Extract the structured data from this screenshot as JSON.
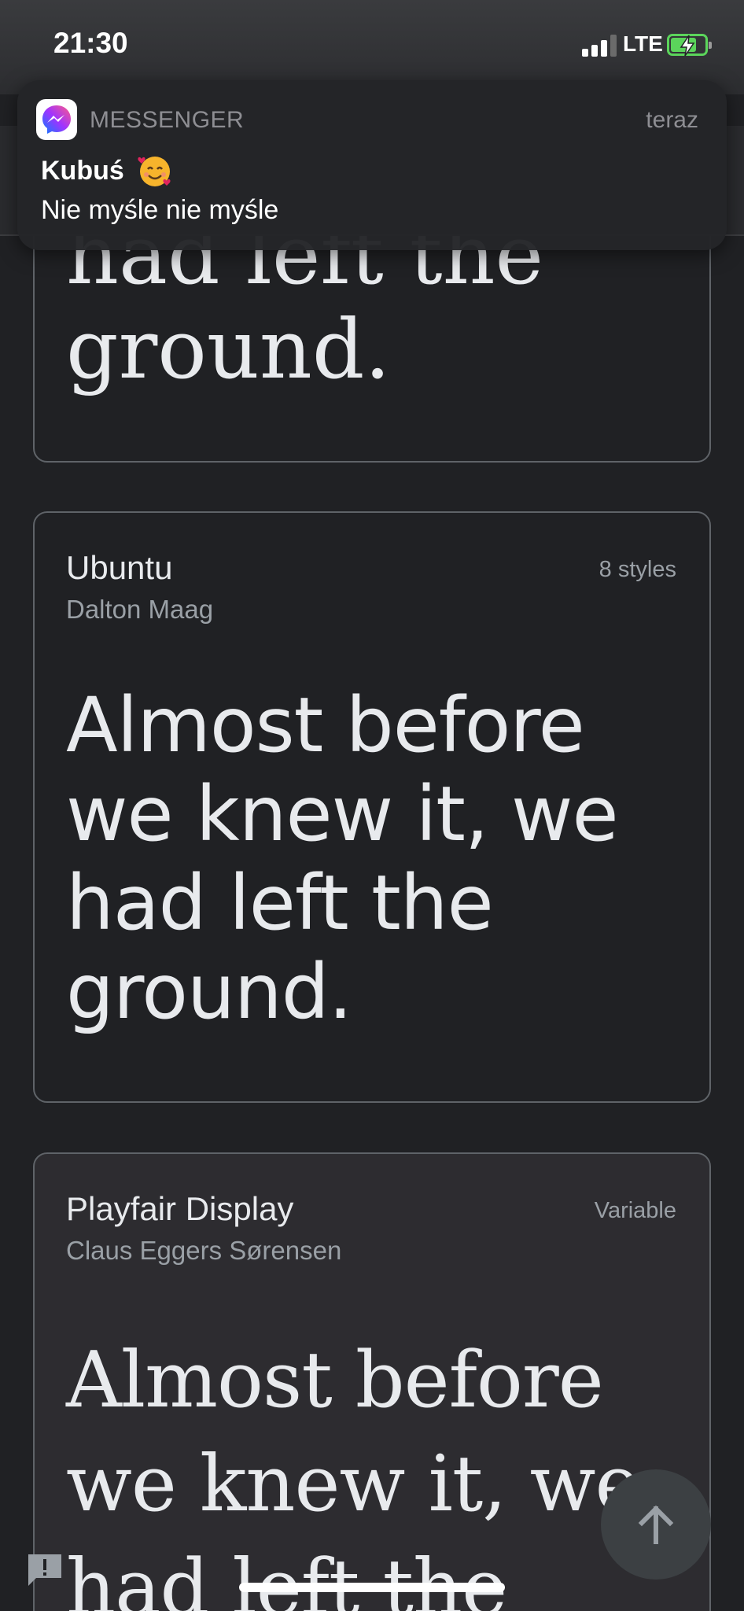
{
  "status_bar": {
    "time": "21:30",
    "network": "LTE"
  },
  "notification": {
    "app_name": "MESSENGER",
    "time": "teraz",
    "sender": "Kubuś",
    "message": "Nie myśle nie myśle"
  },
  "cards": {
    "top_partial": {
      "line1": "had left the",
      "line2": "ground."
    },
    "ubuntu": {
      "title": "Ubuntu",
      "author": "Dalton Maag",
      "meta": "8 styles",
      "preview_lines": [
        "Almost before",
        "we knew it, we",
        "had left the",
        "ground."
      ]
    },
    "playfair": {
      "title": "Playfair Display",
      "author": "Claus Eggers Sørensen",
      "meta": "Variable",
      "preview_lines": [
        "Almost before",
        "we knew it, we",
        "had left the"
      ]
    }
  },
  "icons": {
    "messenger": "messenger-icon",
    "emoji": "smiling-face-with-hearts-icon",
    "fab": "arrow-up-icon",
    "feedback": "feedback-icon"
  },
  "colors": {
    "background": "#202124",
    "card_border": "#5f6368",
    "battery_green": "#5bd45b"
  }
}
